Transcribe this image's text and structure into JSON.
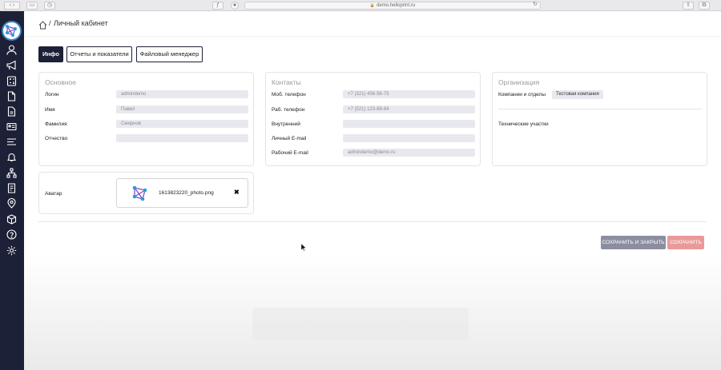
{
  "browser": {
    "url": "demo.helloprint.ru"
  },
  "header": {
    "breadcrumb_separator": "/",
    "title": "Личный кабинет"
  },
  "tabs": [
    {
      "label": "Инфо",
      "active": true
    },
    {
      "label": "Отчеты и показатели",
      "active": false
    },
    {
      "label": "Файловый менеджер",
      "active": false
    }
  ],
  "basic": {
    "title": "Основное",
    "fields": [
      {
        "label": "Логин",
        "value": "admindemo"
      },
      {
        "label": "Имя",
        "value": "Павел"
      },
      {
        "label": "Фамилия",
        "value": "Смирнов"
      },
      {
        "label": "Отчество",
        "value": ""
      }
    ]
  },
  "contacts": {
    "title": "Контакты",
    "fields": [
      {
        "label": "Моб. телефон",
        "value": "+7 (321) 456-56-75"
      },
      {
        "label": "Раб. телефон",
        "value": "+7 (521) 123-69-84"
      },
      {
        "label": "Внутренний",
        "value": ""
      },
      {
        "label": "Личный E-mail",
        "value": ""
      },
      {
        "label": "Рабочий E-mail",
        "value": "admindemo@demo.ru"
      }
    ]
  },
  "organization": {
    "title": "Организация",
    "companies_label": "Компании и отделы",
    "company_badge": "Тестовая компания",
    "sites_label": "Технические участки"
  },
  "avatar": {
    "label": "Аватар",
    "file_name": "1613823220_photo.png",
    "remove_icon": "✖"
  },
  "actions": {
    "save_close": "СОХРАНИТЬ И ЗАКРЫТЬ",
    "save": "СОХРАНИТЬ"
  },
  "colors": {
    "sidebar": "#1c2137",
    "save_close": "#8c8ea0",
    "save": "#e99a98"
  }
}
